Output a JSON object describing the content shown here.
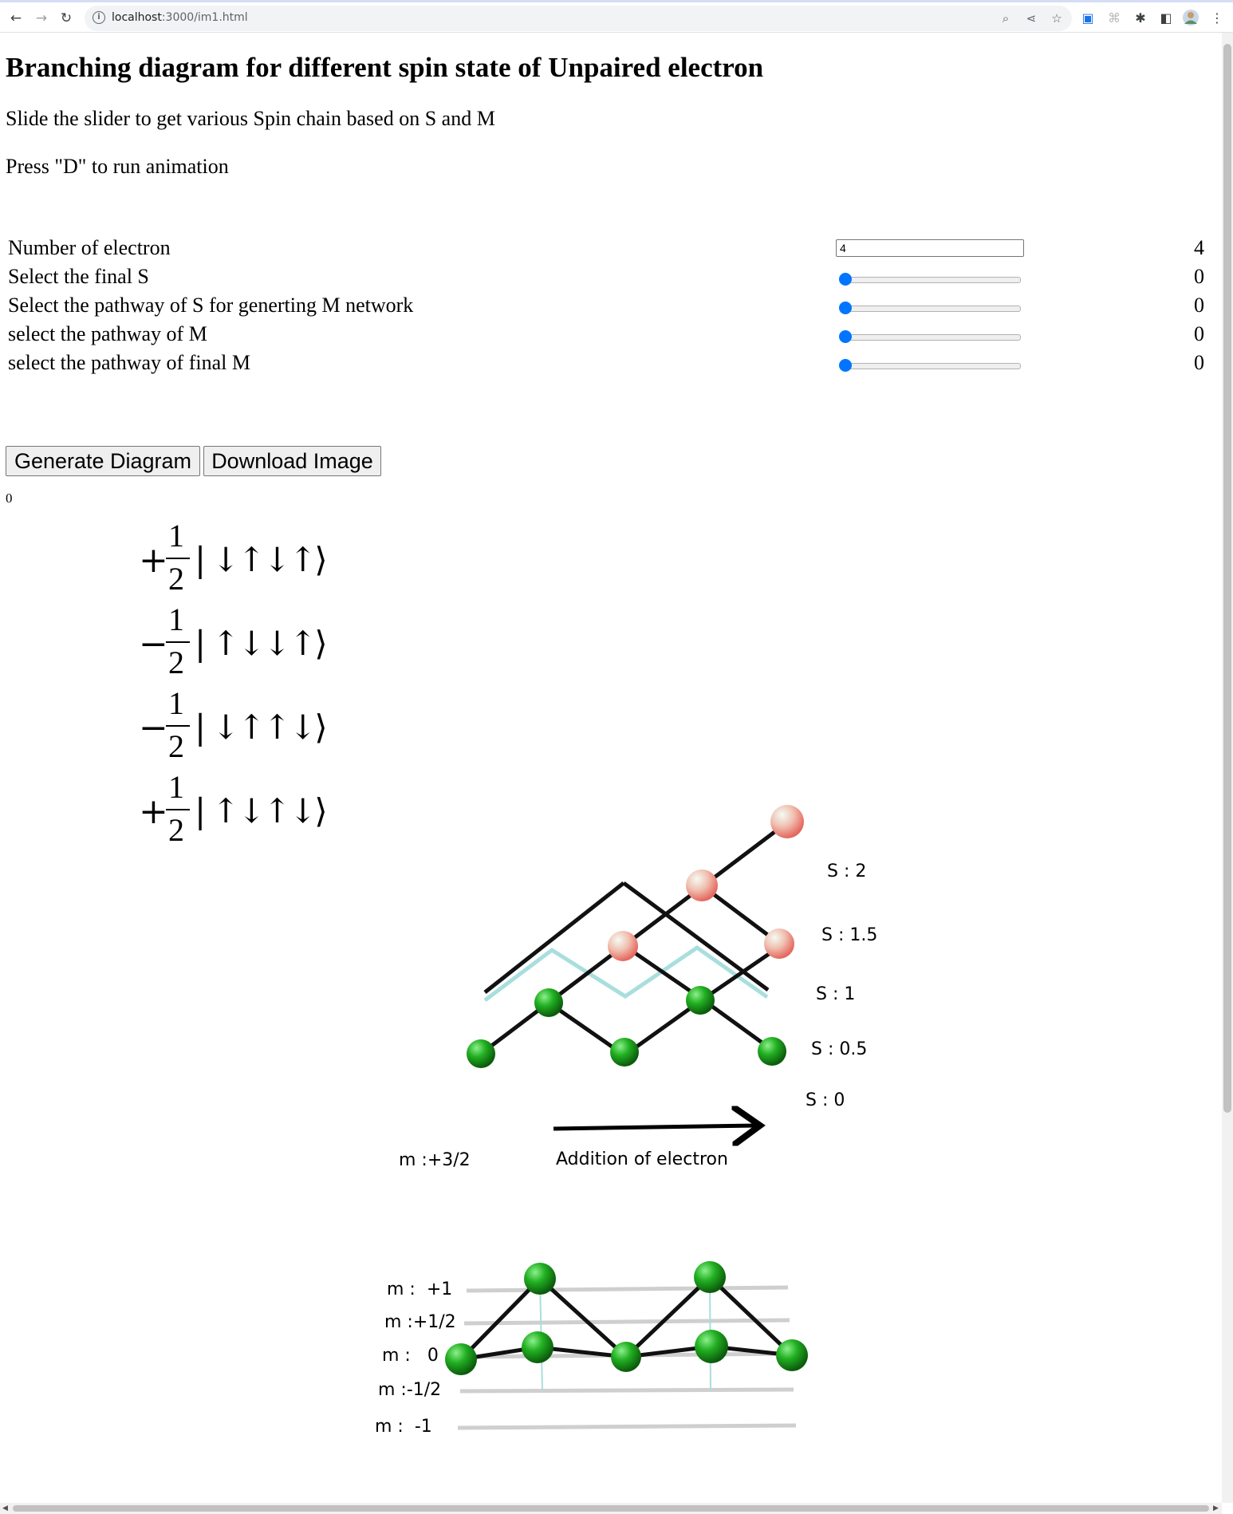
{
  "browser": {
    "url_host": "localhost",
    "url_rest": ":3000/im1.html"
  },
  "page": {
    "title": "Branching diagram for different spin state of Unpaired electron",
    "instruction1": "Slide the slider to get various Spin chain based on S and M",
    "instruction2": "Press \"D\" to run animation"
  },
  "controls": [
    {
      "label": "Number of electron",
      "value": "4",
      "input_value": "4"
    },
    {
      "label": "Select the final S",
      "value": "0",
      "slider_level": 0
    },
    {
      "label": "Select the pathway of S for generting M network",
      "value": "0",
      "slider_level": 0
    },
    {
      "label": "select the pathway of M",
      "value": "0",
      "slider_level": 0
    },
    {
      "label": "select the pathway of final M",
      "value": "0",
      "slider_level": 0
    }
  ],
  "buttons": {
    "generate": "Generate Diagram",
    "download": "Download Image"
  },
  "counter": "0",
  "equation": [
    {
      "sign": "+",
      "num": "1",
      "den": "2",
      "ket": "| ↓↑↓↑⟩"
    },
    {
      "sign": "−",
      "num": "1",
      "den": "2",
      "ket": "| ↑↓↓↑⟩"
    },
    {
      "sign": "−",
      "num": "1",
      "den": "2",
      "ket": "| ↓↑↑↓⟩"
    },
    {
      "sign": "+",
      "num": "1",
      "den": "2",
      "ket": "| ↑↓↑↓⟩"
    }
  ],
  "s_diagram": {
    "levels": [
      "S : 2",
      "S : 1.5",
      "S : 1",
      "S : 0.5",
      "S : 0"
    ],
    "m_label": "m :+3/2",
    "arrow_label": "Addition of electron"
  },
  "m_diagram": {
    "levels": [
      "m :  +1",
      "m :+1/2",
      "m :   0",
      "m :-1/2",
      "m :  -1"
    ]
  },
  "colors": {
    "accent": "#0075ff",
    "green_ball": "#22b022",
    "red_ball": "#e5675f",
    "cyan_path": "#a9dede"
  }
}
